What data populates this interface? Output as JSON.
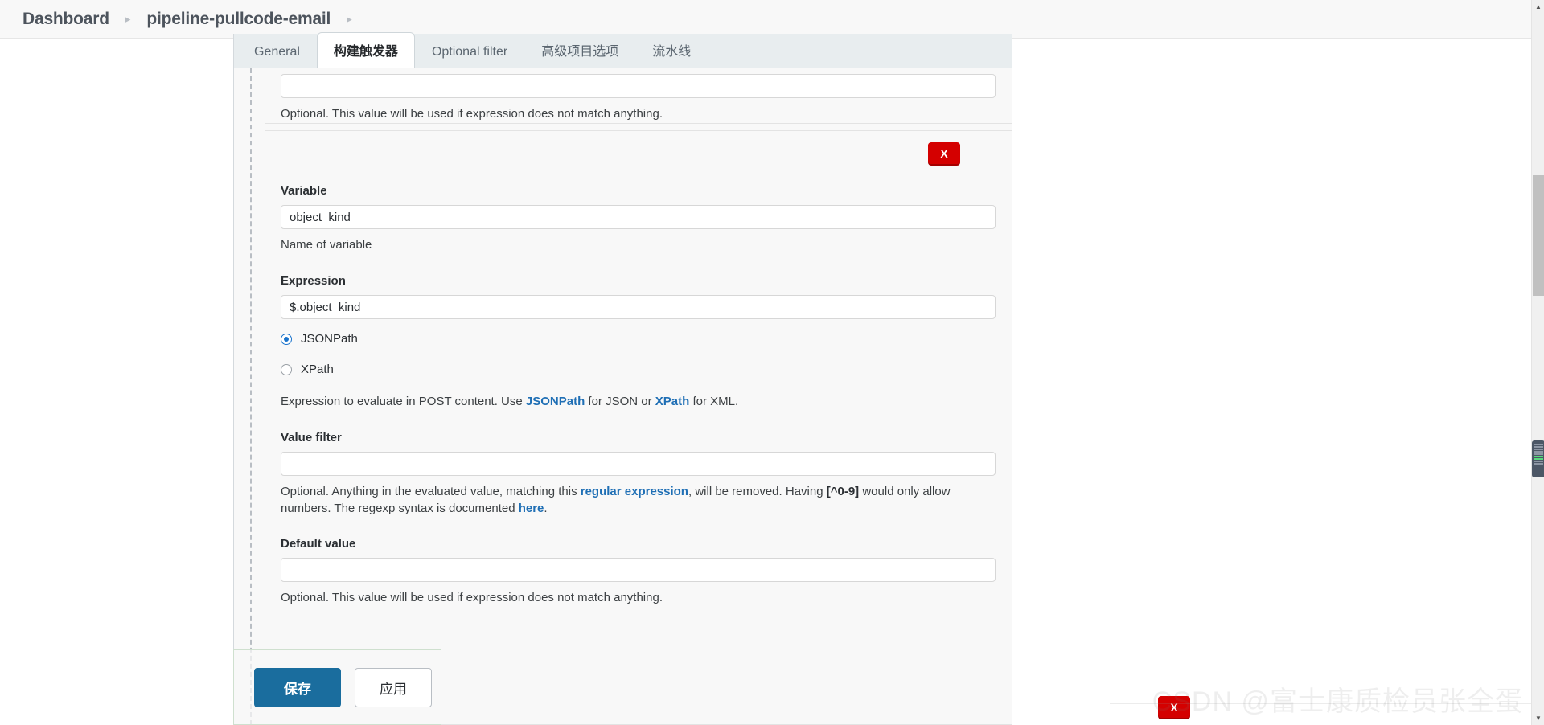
{
  "breadcrumb": {
    "items": [
      {
        "label": "Dashboard"
      },
      {
        "label": "pipeline-pullcode-email"
      }
    ],
    "separator": "▸"
  },
  "tabs": [
    {
      "label": "General",
      "active": false
    },
    {
      "label": "构建触发器",
      "active": true
    },
    {
      "label": "Optional filter",
      "active": false
    },
    {
      "label": "高级项目选项",
      "active": false
    },
    {
      "label": "流水线",
      "active": false
    }
  ],
  "form": {
    "top_partial_help": "Optional. This value will be used if expression does not match anything.",
    "delete_button_label": "X",
    "variable": {
      "label": "Variable",
      "value": "object_kind",
      "placeholder": "",
      "help": "Name of variable"
    },
    "expression": {
      "label": "Expression",
      "value": "$.object_kind",
      "placeholder": "",
      "radios": [
        {
          "label": "JSONPath",
          "checked": true
        },
        {
          "label": "XPath",
          "checked": false
        }
      ],
      "help_prefix": "Expression to evaluate in POST content. Use ",
      "help_link_1": "JSONPath",
      "help_mid": " for JSON or ",
      "help_link_2": "XPath",
      "help_suffix": " for XML."
    },
    "value_filter": {
      "label": "Value filter",
      "value": "",
      "placeholder": "",
      "help_part_1": "Optional. Anything in the evaluated value, matching this ",
      "help_link_1": "regular expression",
      "help_part_2": ", will be removed. Having ",
      "help_code": "[^0-9]",
      "help_part_3": " would only allow numbers. The regexp syntax is documented ",
      "help_link_2": "here",
      "help_part_4": "."
    },
    "default_value": {
      "label": "Default value",
      "value": "",
      "placeholder": "",
      "help": "Optional. This value will be used if expression does not match anything."
    }
  },
  "actions": {
    "save_label": "保存",
    "apply_label": "应用"
  },
  "watermark": "CSDN @富士康质检员张全蛋",
  "scrollbar": {
    "up_arrow": "▲",
    "down_arrow": "▼"
  },
  "colors": {
    "primary_button": "#1a6d9e",
    "delete_button": "#d40000",
    "link": "#1f6fb5",
    "radio_selected": "#1a73cc",
    "tab_strip_bg": "#e8edef"
  }
}
